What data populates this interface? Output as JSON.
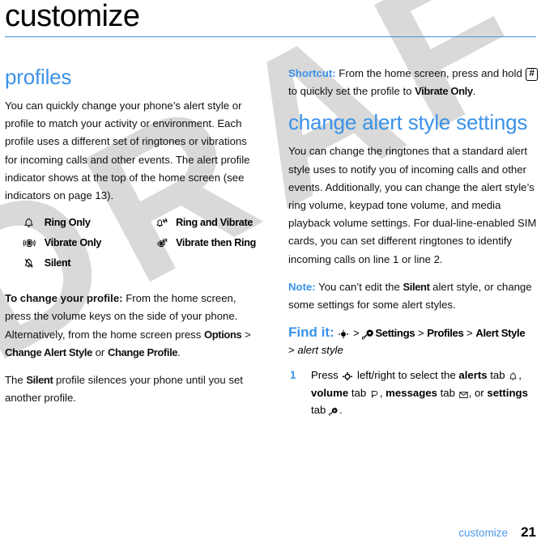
{
  "document": {
    "chapter_title": "customize",
    "footer_label": "customize",
    "page_number": "21",
    "watermark": "DRAFT",
    "accent_color": "#3b92e8",
    "rule_color": "#3c8fde"
  },
  "left_column": {
    "section_title": "profiles",
    "intro": "You can quickly change your phone’s alert style or profile to match your activity or environment. Each profile uses a different set of ringtones or vibrations for incoming calls and other events. The alert profile indicator shows at the top of the home screen (see indicators on page 13).",
    "profiles": [
      {
        "icon": "bell-icon",
        "label": "Ring Only"
      },
      {
        "icon": "ring-vibrate-icon",
        "label": "Ring and Vibrate"
      },
      {
        "icon": "vibrate-icon",
        "label": "Vibrate Only"
      },
      {
        "icon": "vibrate-then-ring-icon",
        "label": "Vibrate then Ring"
      },
      {
        "icon": "silent-bell-icon",
        "label": "Silent"
      }
    ],
    "change_profile": {
      "lead": "To change your profile:",
      "text_1": " From the home screen, press the volume keys on the side of your phone. Alternatively, from the home screen press ",
      "ui_options": "Options",
      "sep_1": " > ",
      "ui_change_alert_style": "Change Alert Style",
      "text_2": " or ",
      "ui_change_profile": "Change Profile",
      "text_3": "."
    },
    "silent_note": {
      "text_1": "The ",
      "ui_silent": "Silent",
      "text_2": " profile silences your phone until you set another profile."
    }
  },
  "right_column": {
    "shortcut": {
      "lead": "Shortcut:",
      "text_1": " From the home screen, press and hold ",
      "key": "#",
      "text_2": " to quickly set the profile to ",
      "ui_vibrate_only": "Vibrate Only",
      "text_3": "."
    },
    "section_title": "change alert style settings",
    "intro": "You can change the ringtones that a standard alert style uses to notify you of incoming calls and other events. Additionally, you can change the alert style’s ring volume, keypad tone volume, and media playback volume settings. For dual-line-enabled SIM cards, you can set different ringtones to identify incoming calls on line 1 or line 2.",
    "note": {
      "lead": "Note:",
      "text_1": " You can’t edit the ",
      "ui_silent": "Silent",
      "text_2": " alert style, or change some settings for some alert styles."
    },
    "find_it": {
      "lead": "Find it:",
      "center_key_icon": "center-select-key-icon",
      "sep_1": " > ",
      "settings_icon": "settings-gear-icon",
      "ui_settings": "Settings",
      "sep_2": " > ",
      "ui_profiles": "Profiles",
      "sep_3": " > ",
      "ui_alert_style": "Alert Style",
      "sep_4": "> ",
      "italic_alert_style": "alert style"
    },
    "step_1": {
      "number": "1",
      "text_1": "Press ",
      "nav_key_icon": "navigation-key-icon",
      "text_2": " left/right to select the ",
      "b_alerts": "alerts",
      "text_3": " tab ",
      "alerts_icon": "bell-icon",
      "text_4": ", ",
      "b_volume": "volume",
      "text_5": " tab ",
      "volume_icon": "speaker-icon",
      "text_6": ", ",
      "b_messages": "messages",
      "text_7": " tab ",
      "messages_icon": "envelope-icon",
      "text_8": ", or ",
      "b_settings": "settings",
      "text_9": " tab ",
      "settings_icon": "settings-gear-icon",
      "text_10": "."
    }
  }
}
